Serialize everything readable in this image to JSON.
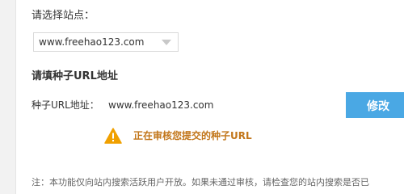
{
  "site_select": {
    "label": "请选择站点：",
    "selected": "www.freehao123.com"
  },
  "seed_section": {
    "title": "请填种子URL地址",
    "label": "种子URL地址：",
    "value": "www.freehao123.com",
    "modify_label": "修改"
  },
  "status": {
    "icon": "warning-icon",
    "text": "正在审核您提交的种子URL"
  },
  "note": "注：本功能仅向站内搜索活跃用户开放。如果未通过审核，请检查您的站内搜索是否已",
  "colors": {
    "button": "#4aa8e4",
    "status_text": "#c2761a",
    "warning_icon": "#f0a000"
  }
}
